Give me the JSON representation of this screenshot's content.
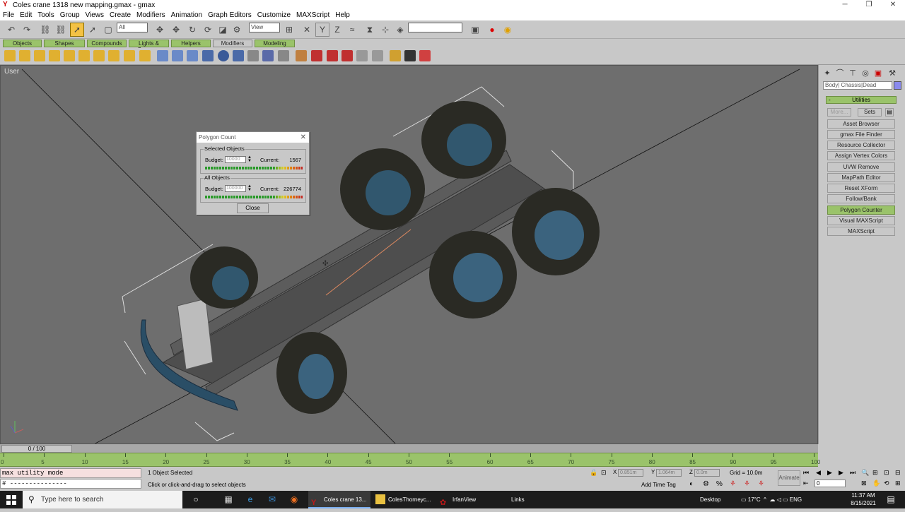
{
  "window": {
    "title": "Coles crane 1318 new mapping.gmax - gmax"
  },
  "menu": [
    "File",
    "Edit",
    "Tools",
    "Group",
    "Views",
    "Create",
    "Modifiers",
    "Animation",
    "Graph Editors",
    "Customize",
    "MAXScript",
    "Help"
  ],
  "toolbar": {
    "selection_filter": "All",
    "coord_system": "View",
    "named_sel": ""
  },
  "tabs": [
    "Objects",
    "Shapes",
    "Compounds",
    "Lights & Cameras",
    "Helpers",
    "Modifiers",
    "Modeling"
  ],
  "active_tab": "Modifiers",
  "viewport": {
    "label": "User"
  },
  "command_panel": {
    "object_name": "Body| Chassis|Dead",
    "object_color": "#8a8aee",
    "rollout_title": "Utilities",
    "more_label": "More...",
    "sets_label": "Sets",
    "utilities": [
      "Asset Browser",
      "gmax File Finder",
      "Resource Collector",
      "Assign Vertex Colors",
      "UVW Remove",
      "MapPath Editor",
      "Reset XForm",
      "Follow/Bank",
      "Polygon Counter",
      "Visual MAXScript",
      "MAXScript"
    ],
    "active_utility": "Polygon Counter"
  },
  "dialog": {
    "title": "Polygon Count",
    "selected": {
      "label": "Selected Objects",
      "budget_label": "Budget:",
      "budget": "10000",
      "current_label": "Current:",
      "current": "1567"
    },
    "all": {
      "label": "All Objects",
      "budget_label": "Budget:",
      "budget": "100000",
      "current_label": "Current:",
      "current": "226774"
    },
    "close_label": "Close"
  },
  "timeline": {
    "slider": "0 / 100",
    "ticks": [
      "0",
      "5",
      "10",
      "15",
      "20",
      "25",
      "30",
      "35",
      "40",
      "45",
      "50",
      "55",
      "60",
      "65",
      "70",
      "75",
      "80",
      "85",
      "90",
      "95",
      "100"
    ]
  },
  "status": {
    "maxscript_output": "max utility mode",
    "maxscript_input": "# ---------------",
    "selection": "1 Object Selected",
    "prompt": "Click or click-and-drag to select objects",
    "x_label": "X",
    "x": "0.851m",
    "y_label": "Y",
    "y": "1.064m",
    "z_label": "Z",
    "z": "0.0m",
    "grid": "Grid = 10.0m",
    "add_time_tag": "Add Time Tag",
    "animate": "Animate",
    "frame": "0"
  },
  "taskbar": {
    "search_placeholder": "Type here to search",
    "apps": [
      {
        "label": "Coles crane 13...",
        "color": "#c01818"
      },
      {
        "label": "ColesThorneyc...",
        "color": "#e8c040"
      },
      {
        "label": "IrfanView",
        "color": "#c01818"
      }
    ],
    "links": "Links",
    "desktop": "Desktop",
    "temperature": "17°C",
    "lang": "ENG",
    "time": "11:37 AM",
    "date": "8/15/2021"
  }
}
